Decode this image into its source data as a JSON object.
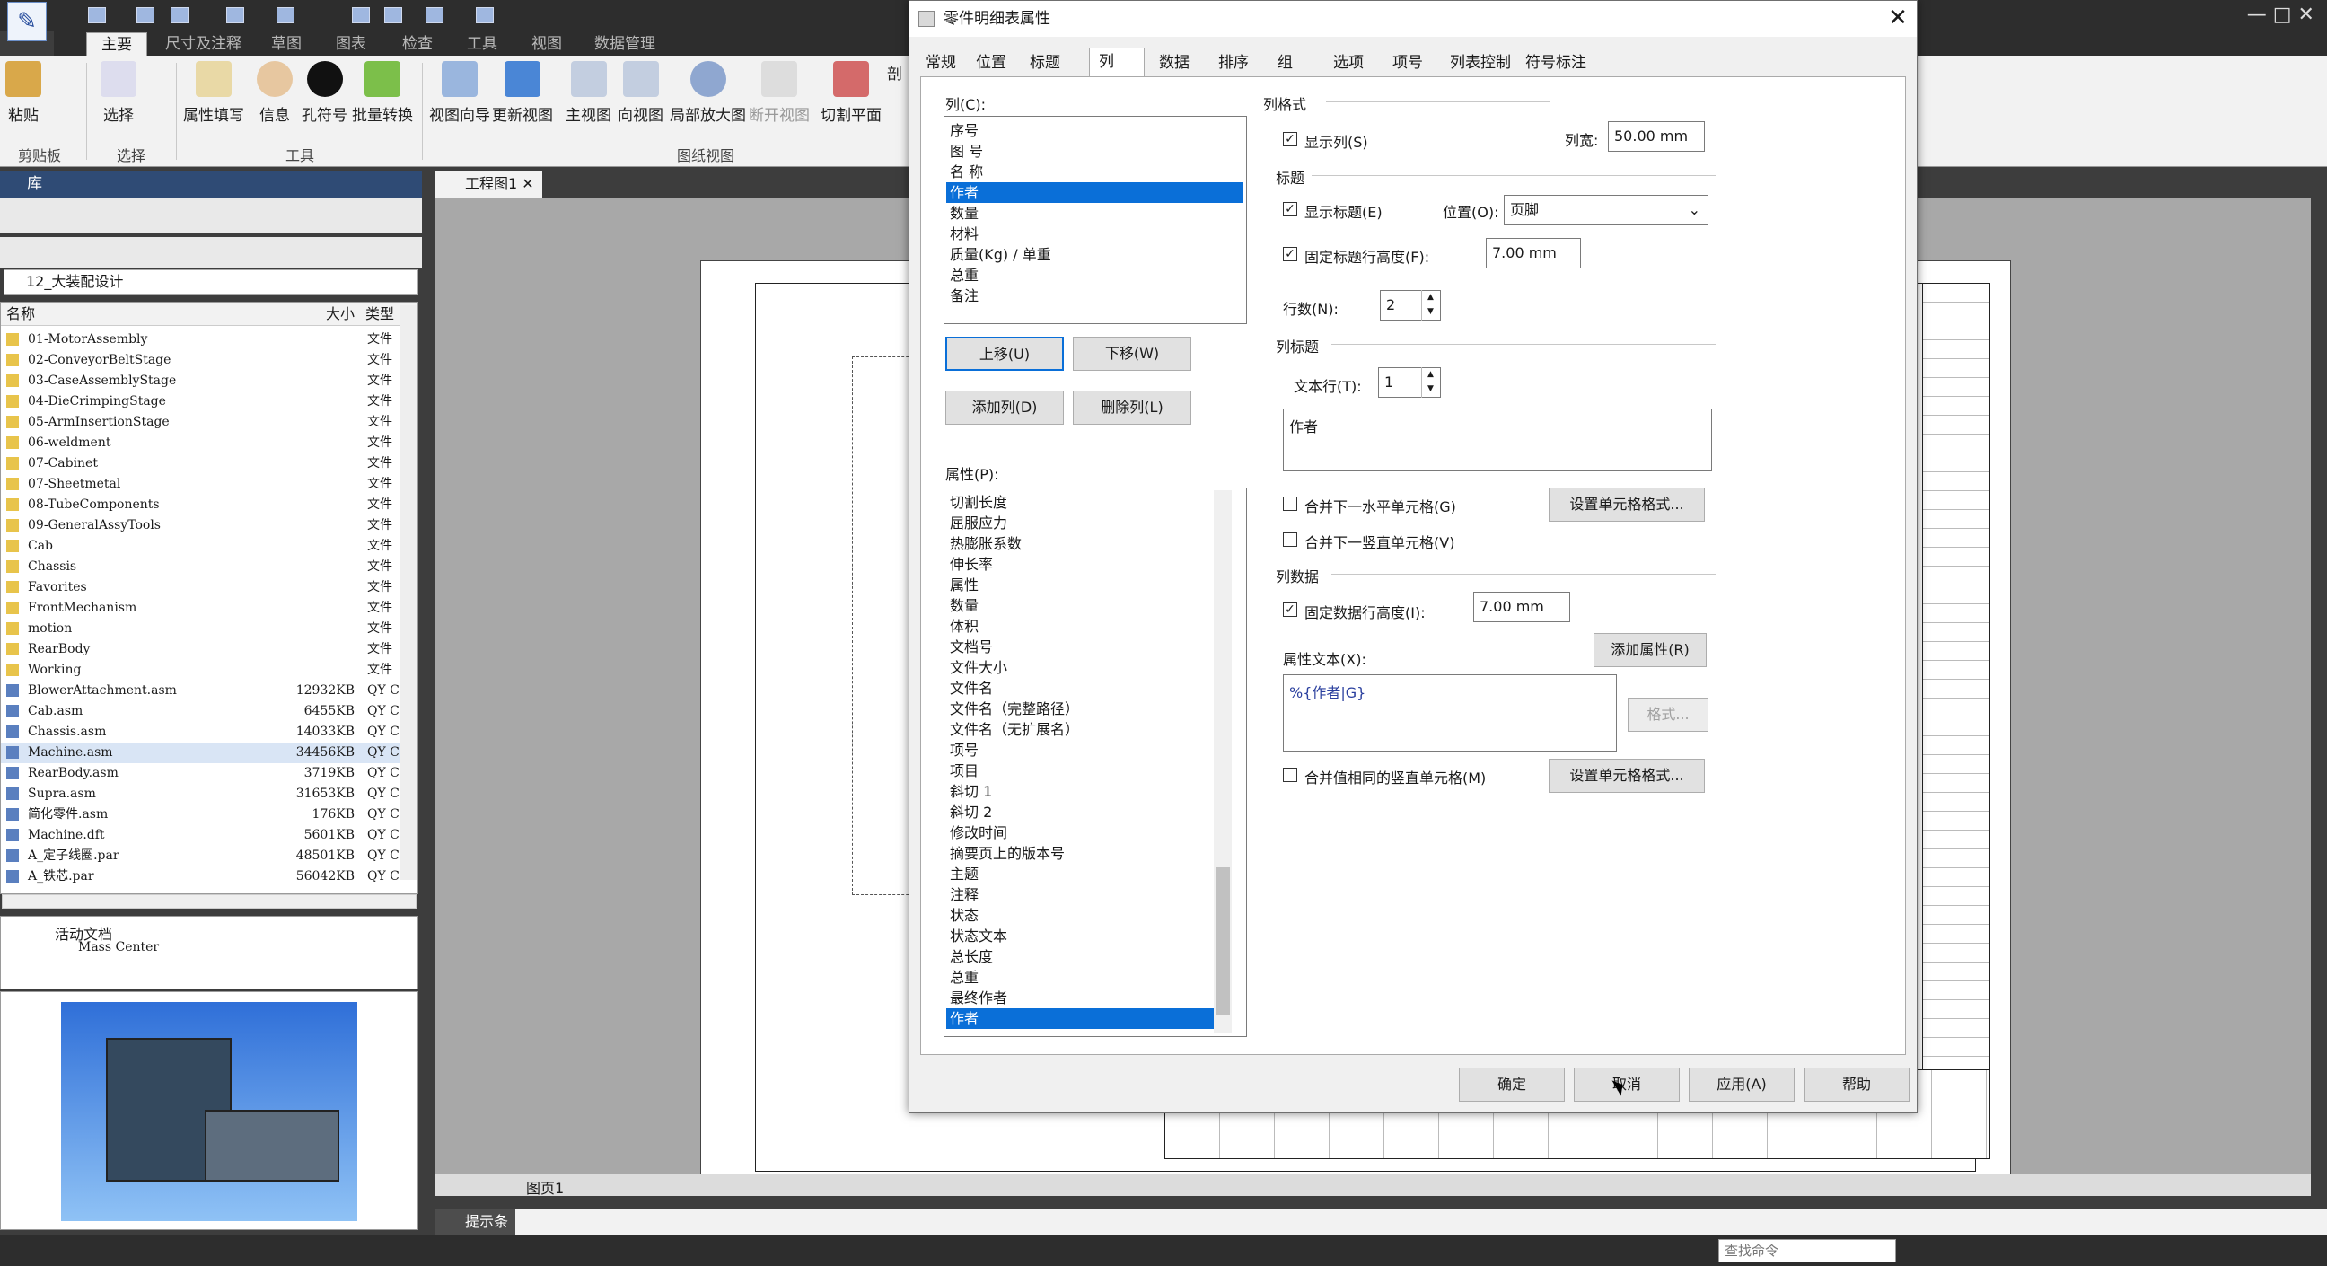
{
  "ribbon": {
    "tabs": [
      "主要",
      "尺寸及注释",
      "草图",
      "图表",
      "检查",
      "工具",
      "视图",
      "数据管理"
    ],
    "buttons": [
      "粘贴",
      "选择",
      "属性填写",
      "信息",
      "孔符号",
      "批量转换",
      "视图向导",
      "更新视图",
      "主视图",
      "向视图",
      "局部放大图",
      "断开视图",
      "切割平面",
      "剖"
    ],
    "groups": [
      "剪贴板",
      "选择",
      "工具",
      "图纸视图"
    ]
  },
  "library": {
    "title": "库",
    "folder": "12_大装配设计",
    "col_name": "名称",
    "col_size": "大小",
    "col_type": "类型",
    "files": [
      {
        "name": "01-MotorAssembly",
        "size": "",
        "type": "文件"
      },
      {
        "name": "02-ConveyorBeltStage",
        "size": "",
        "type": "文件"
      },
      {
        "name": "03-CaseAssemblyStage",
        "size": "",
        "type": "文件"
      },
      {
        "name": "04-DieCrimpingStage",
        "size": "",
        "type": "文件"
      },
      {
        "name": "05-ArmInsertionStage",
        "size": "",
        "type": "文件"
      },
      {
        "name": "06-weldment",
        "size": "",
        "type": "文件"
      },
      {
        "name": "07-Cabinet",
        "size": "",
        "type": "文件"
      },
      {
        "name": "07-Sheetmetal",
        "size": "",
        "type": "文件"
      },
      {
        "name": "08-TubeComponents",
        "size": "",
        "type": "文件"
      },
      {
        "name": "09-GeneralAssyTools",
        "size": "",
        "type": "文件"
      },
      {
        "name": "Cab",
        "size": "",
        "type": "文件"
      },
      {
        "name": "Chassis",
        "size": "",
        "type": "文件"
      },
      {
        "name": "Favorites",
        "size": "",
        "type": "文件"
      },
      {
        "name": "FrontMechanism",
        "size": "",
        "type": "文件"
      },
      {
        "name": "motion",
        "size": "",
        "type": "文件"
      },
      {
        "name": "RearBody",
        "size": "",
        "type": "文件"
      },
      {
        "name": "Working",
        "size": "",
        "type": "文件"
      },
      {
        "name": "BlowerAttachment.asm",
        "size": "12932KB",
        "type": "QY C"
      },
      {
        "name": "Cab.asm",
        "size": "6455KB",
        "type": "QY C"
      },
      {
        "name": "Chassis.asm",
        "size": "14033KB",
        "type": "QY C"
      },
      {
        "name": "Machine.asm",
        "size": "34456KB",
        "type": "QY C"
      },
      {
        "name": "RearBody.asm",
        "size": "3719KB",
        "type": "QY C"
      },
      {
        "name": "Supra.asm",
        "size": "31653KB",
        "type": "QY C"
      },
      {
        "name": "简化零件.asm",
        "size": "176KB",
        "type": "QY C"
      },
      {
        "name": "Machine.dft",
        "size": "5601KB",
        "type": "QY C"
      },
      {
        "name": "A_定子线圈.par",
        "size": "48501KB",
        "type": "QY C"
      },
      {
        "name": "A_铁芯.par",
        "size": "56042KB",
        "type": "QY C"
      }
    ],
    "tree_root": "活动文档",
    "tree_child": "Mass Center"
  },
  "doc": {
    "tab": "工程图1",
    "page_tab": "图页1",
    "prompt": "提示条",
    "cmd_search": "查找命令"
  },
  "dialog": {
    "title": "零件明细表属性",
    "tabs": [
      "常规",
      "位置",
      "标题",
      "列",
      "数据",
      "排序",
      "组",
      "选项",
      "项号",
      "列表控制",
      "符号标注"
    ],
    "columns_label": "列(C):",
    "columns": [
      "序号",
      "图 号",
      "名 称",
      "作者",
      "数量",
      "材料",
      "质量(Kg) / 单重",
      "总重",
      "备注"
    ],
    "btn_up": "上移(U)",
    "btn_down": "下移(W)",
    "btn_add": "添加列(D)",
    "btn_delete": "删除列(L)",
    "props_label": "属性(P):",
    "props": [
      "切割长度",
      "屈服应力",
      "热膨胀系数",
      "伸长率",
      "属性",
      "数量",
      "体积",
      "文档号",
      "文件大小",
      "文件名",
      "文件名（完整路径）",
      "文件名（无扩展名）",
      "项号",
      "项目",
      "斜切 1",
      "斜切 2",
      "修改时间",
      "摘要页上的版本号",
      "主题",
      "注释",
      "状态",
      "状态文本",
      "总长度",
      "总重",
      "最终作者",
      "作者"
    ],
    "col_format": "列格式",
    "show_column": "显示列(S)",
    "col_width_label": "列宽:",
    "col_width": "50.00 mm",
    "title_section": "标题",
    "show_title": "显示标题(E)",
    "position_label": "位置(O):",
    "position": "页脚",
    "fix_title_height": "固定标题行高度(F):",
    "title_height": "7.00 mm",
    "rows_label": "行数(N):",
    "rows": "2",
    "col_title": "列标题",
    "text_rows_label": "文本行(T):",
    "text_rows": "1",
    "title_text": "作者",
    "merge_h": "合并下一水平单元格(G)",
    "set_cell_format": "设置单元格格式...",
    "merge_v": "合并下一竖直单元格(V)",
    "col_data": "列数据",
    "fix_data_height": "固定数据行高度(I):",
    "data_height": "7.00 mm",
    "prop_text_label": "属性文本(X):",
    "add_property": "添加属性(R)",
    "prop_text": "%{作者|G}",
    "format_btn": "格式...",
    "merge_same": "合并值相同的竖直单元格(M)",
    "set_cell_format2": "设置单元格格式...",
    "ok": "确定",
    "cancel": "取消",
    "apply": "应用(A)",
    "help": "帮助"
  }
}
